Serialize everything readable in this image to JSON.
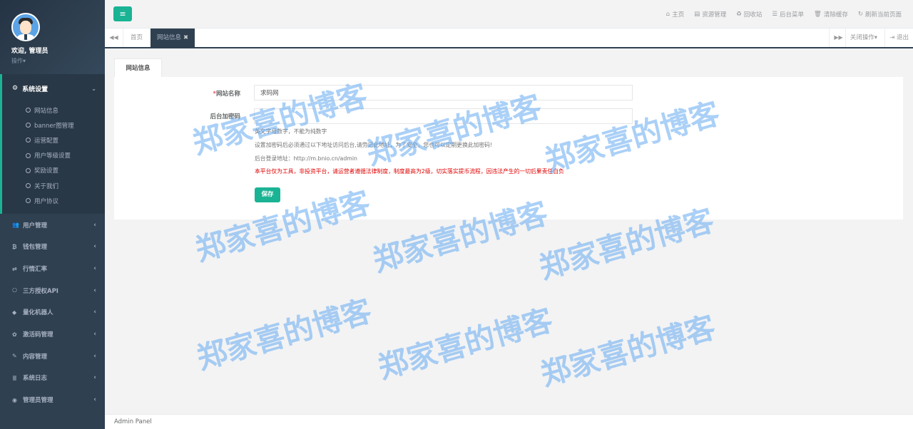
{
  "sidebar": {
    "welcome": "欢迎, 管理员",
    "operate": "操作▾",
    "group": {
      "label": "系统设置",
      "items": [
        "网站信息",
        "banner图管理",
        "运营配置",
        "用户等级设置",
        "奖励设置",
        "关于我们",
        "用户协议"
      ]
    },
    "items": [
      {
        "label": "用户管理",
        "icon": "users-icon"
      },
      {
        "label": "钱包管理",
        "icon": "bitcoin-icon"
      },
      {
        "label": "行情汇率",
        "icon": "exchange-icon"
      },
      {
        "label": "三方授权API",
        "icon": "api-icon"
      },
      {
        "label": "量化机器人",
        "icon": "robot-icon"
      },
      {
        "label": "激活码管理",
        "icon": "cog-icon"
      },
      {
        "label": "内容管理",
        "icon": "edit-icon"
      },
      {
        "label": "系统日志",
        "icon": "database-icon"
      },
      {
        "label": "管理员管理",
        "icon": "user-circle-icon"
      }
    ]
  },
  "topbar": {
    "links": [
      "主页",
      "资源管理",
      "回收站",
      "后台菜单",
      "清除缓存",
      "刷新当前页面"
    ]
  },
  "tabs": {
    "home": "首页",
    "active": "网站信息",
    "close_ops": "关闭操作▾",
    "logout": "退出"
  },
  "form": {
    "tab": "网站信息",
    "site_name_label": "网站名称",
    "site_name_value": "求码网",
    "password_label": "后台加密码",
    "help1": "英文字母数字，不能为纯数字",
    "help2": "设置加密码后必须通过以下地址访问后台,请劳记此地址，为了安全，您也可以定期更换此加密码!",
    "help3": "后台登录地址：http://m.bnio.cn/admin",
    "warning": "本平台仅为工具，非投资平台，请运营者遵循法律制度，制度最高为2级，切实落实提币流程，因违法产生的一切后果责任自负",
    "save": "保存"
  },
  "footer": "Admin Panel",
  "watermark": "郑家喜的博客",
  "colors": {
    "accent": "#1ab394",
    "sidebar": "#2f4050",
    "warning": "#e10000"
  }
}
